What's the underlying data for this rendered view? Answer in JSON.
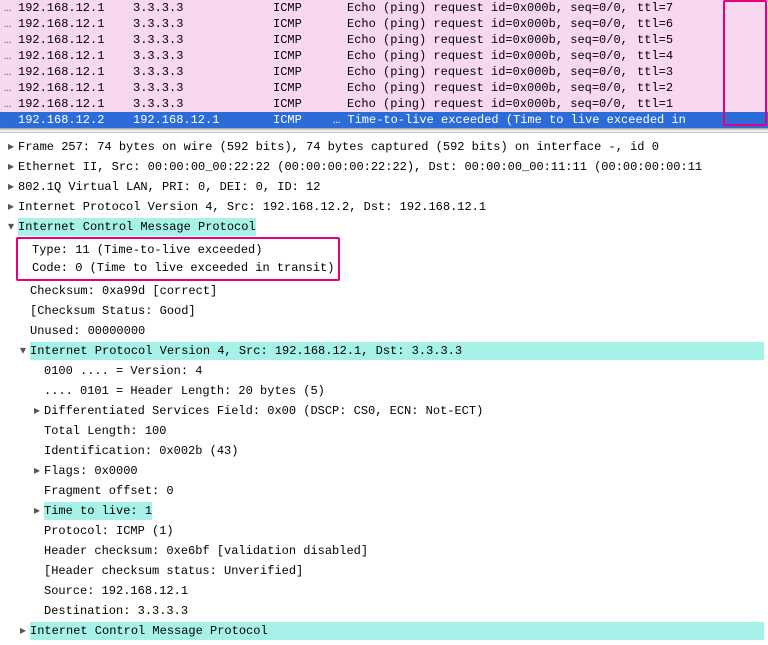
{
  "packet_list": {
    "rows": [
      {
        "src": "192.168.12.1",
        "dst": "3.3.3.3",
        "proto": "ICMP",
        "info": "Echo (ping) request  id=0x000b, seq=0/0,",
        "ttl": "ttl=7",
        "cls": "pink"
      },
      {
        "src": "192.168.12.1",
        "dst": "3.3.3.3",
        "proto": "ICMP",
        "info": "Echo (ping) request  id=0x000b, seq=0/0,",
        "ttl": "ttl=6",
        "cls": "pink"
      },
      {
        "src": "192.168.12.1",
        "dst": "3.3.3.3",
        "proto": "ICMP",
        "info": "Echo (ping) request  id=0x000b, seq=0/0,",
        "ttl": "ttl=5",
        "cls": "pink"
      },
      {
        "src": "192.168.12.1",
        "dst": "3.3.3.3",
        "proto": "ICMP",
        "info": "Echo (ping) request  id=0x000b, seq=0/0,",
        "ttl": "ttl=4",
        "cls": "pink"
      },
      {
        "src": "192.168.12.1",
        "dst": "3.3.3.3",
        "proto": "ICMP",
        "info": "Echo (ping) request  id=0x000b, seq=0/0,",
        "ttl": "ttl=3",
        "cls": "pink"
      },
      {
        "src": "192.168.12.1",
        "dst": "3.3.3.3",
        "proto": "ICMP",
        "info": "Echo (ping) request  id=0x000b, seq=0/0,",
        "ttl": "ttl=2",
        "cls": "pink"
      },
      {
        "src": "192.168.12.1",
        "dst": "3.3.3.3",
        "proto": "ICMP",
        "info": "Echo (ping) request  id=0x000b, seq=0/0,",
        "ttl": "ttl=1",
        "cls": "pink"
      },
      {
        "src": "192.168.12.2",
        "dst": "192.168.12.1",
        "proto": "ICMP",
        "info": "… Time-to-live exceeded (Time to live exceeded in",
        "ttl": "",
        "cls": "selected"
      }
    ]
  },
  "detail": {
    "frame": "Frame 257: 74 bytes on wire (592 bits), 74 bytes captured (592 bits) on interface -, id 0",
    "eth": "Ethernet II, Src: 00:00:00_00:22:22 (00:00:00:00:22:22), Dst: 00:00:00_00:11:11 (00:00:00:00:11",
    "vlan": "802.1Q Virtual LAN, PRI: 0, DEI: 0, ID: 12",
    "ipv4_outer": "Internet Protocol Version 4, Src: 192.168.12.2, Dst: 192.168.12.1",
    "icmp_header": "Internet Control Message Protocol",
    "icmp_type": "Type: 11 (Time-to-live exceeded)",
    "icmp_code": "Code: 0 (Time to live exceeded in transit)",
    "checksum": "Checksum: 0xa99d [correct]",
    "checksum_status": "[Checksum Status: Good]",
    "unused": "Unused: 00000000",
    "ipv4_inner": "Internet Protocol Version 4, Src: 192.168.12.1, Dst: 3.3.3.3",
    "inner_version": "0100 .... = Version: 4",
    "inner_hlen": ".... 0101 = Header Length: 20 bytes (5)",
    "inner_dsf": "Differentiated Services Field: 0x00 (DSCP: CS0, ECN: Not-ECT)",
    "inner_tlen": "Total Length: 100",
    "inner_id": "Identification: 0x002b (43)",
    "inner_flags": "Flags: 0x0000",
    "inner_fragoff": "Fragment offset: 0",
    "inner_ttl": "Time to live: 1",
    "inner_proto": "Protocol: ICMP (1)",
    "inner_hchk": "Header checksum: 0xe6bf [validation disabled]",
    "inner_hchk_status": "[Header checksum status: Unverified]",
    "inner_src": "Source: 192.168.12.1",
    "inner_dst": "Destination: 3.3.3.3",
    "icmp_inner": "Internet Control Message Protocol"
  },
  "glyph": {
    "collapsed": "▸",
    "expanded": "▾",
    "ellipsis": "…"
  }
}
